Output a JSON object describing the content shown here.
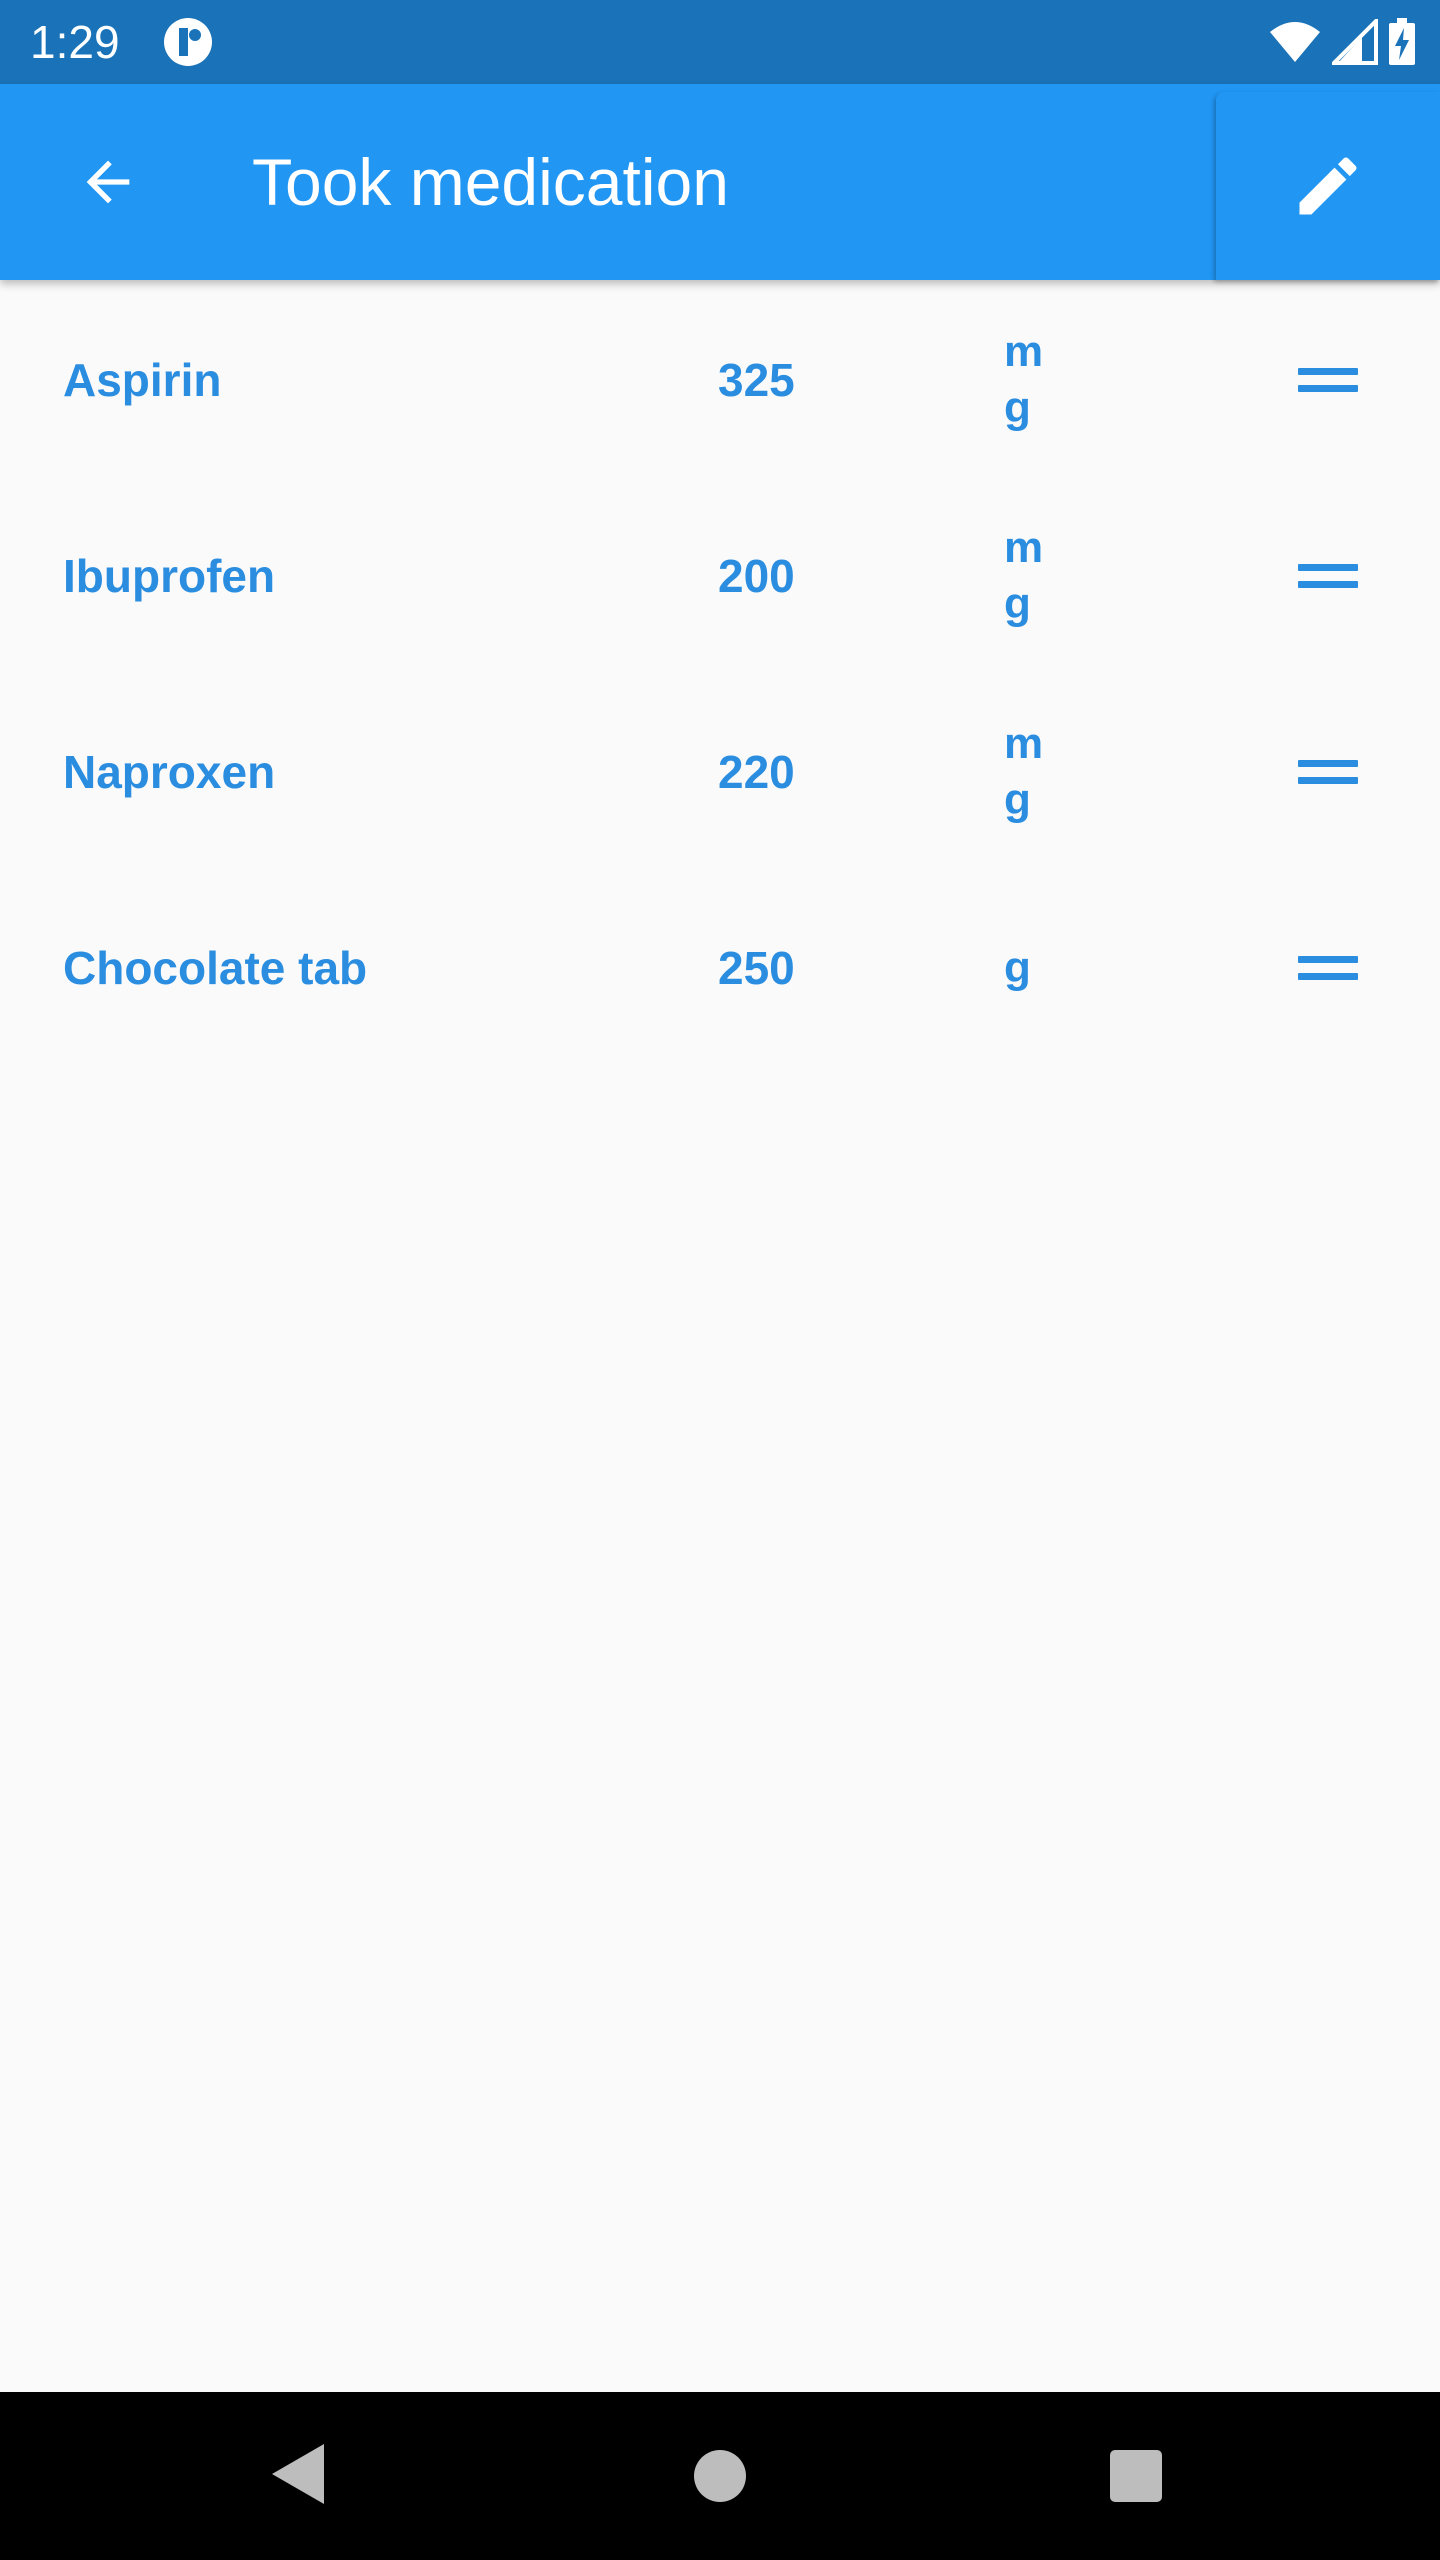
{
  "status_bar": {
    "time": "1:29",
    "icons": [
      "app-notification-icon",
      "wifi-icon",
      "cell-signal-icon",
      "battery-charging-icon"
    ]
  },
  "app_bar": {
    "title": "Took medication",
    "back_icon": "arrow-back-icon",
    "edit_icon": "pencil-icon"
  },
  "medications": [
    {
      "name": "Aspirin",
      "dose": "325",
      "unit": "mg"
    },
    {
      "name": "Ibuprofen",
      "dose": "200",
      "unit": "mg"
    },
    {
      "name": "Naproxen",
      "dose": "220",
      "unit": "mg"
    },
    {
      "name": "Chocolate tab",
      "dose": "250",
      "unit": "g"
    }
  ],
  "nav_bar": {
    "icons": [
      "nav-back-icon",
      "nav-home-icon",
      "nav-recents-icon"
    ]
  },
  "colors": {
    "status_bar": "#1a73b8",
    "app_bar": "#2196f3",
    "text_accent": "#2a8de0",
    "background": "#fafafa"
  }
}
